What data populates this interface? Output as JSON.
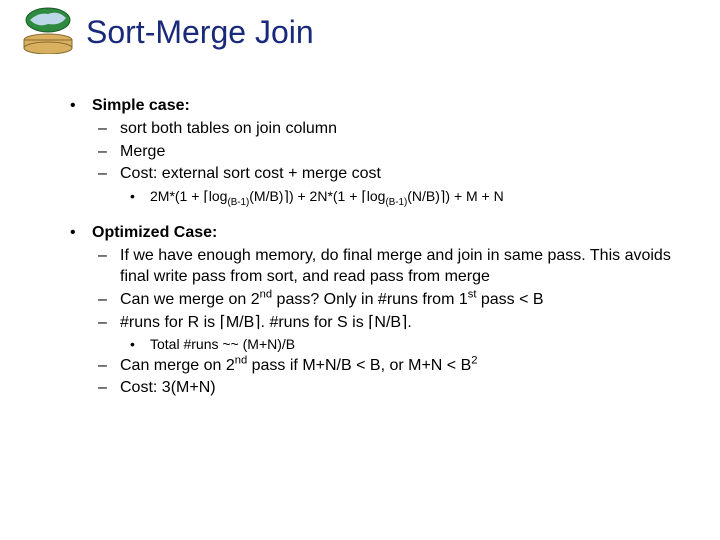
{
  "icon": "earth-db-icon",
  "title": "Sort-Merge Join",
  "s1": {
    "head": "Simple case:",
    "l1": "sort both tables on join column",
    "l2": "Merge",
    "l3": "Cost: external sort cost + merge cost",
    "formula_a": "2M*(1 + ",
    "formula_b": "log",
    "formula_c": "(B-1)",
    "formula_d": "(M/B)",
    "formula_e": ") + 2N*(1 + ",
    "formula_f": "log",
    "formula_g": "(B-1)",
    "formula_h": "(N/B)",
    "formula_i": ") + M + N"
  },
  "s2": {
    "head": "Optimized Case:",
    "l1": "If we have enough memory, do final merge and join in same pass.  This avoids final write pass from sort, and read pass from merge",
    "l2a": "Can we merge on 2",
    "l2b": "nd",
    "l2c": " pass?  Only in #runs from 1",
    "l2d": "st",
    "l2e": " pass < B",
    "l3a": "#runs for R is ",
    "l3b": "M/B",
    "l3c": ".  #runs for S is ",
    "l3d": "N/B",
    "l3e": ".",
    "sub": "Total #runs ~~ (M+N)/B",
    "l4a": "Can merge on 2",
    "l4b": "nd",
    "l4c": " pass if  M+N/B < B, or M+N < B",
    "l4d": "2",
    "l5": "Cost: 3(M+N)"
  },
  "bullets": {
    "l1": "•",
    "l2": "–",
    "l3": "•"
  },
  "ceil": {
    "l": "⌈",
    "r": "⌉"
  }
}
